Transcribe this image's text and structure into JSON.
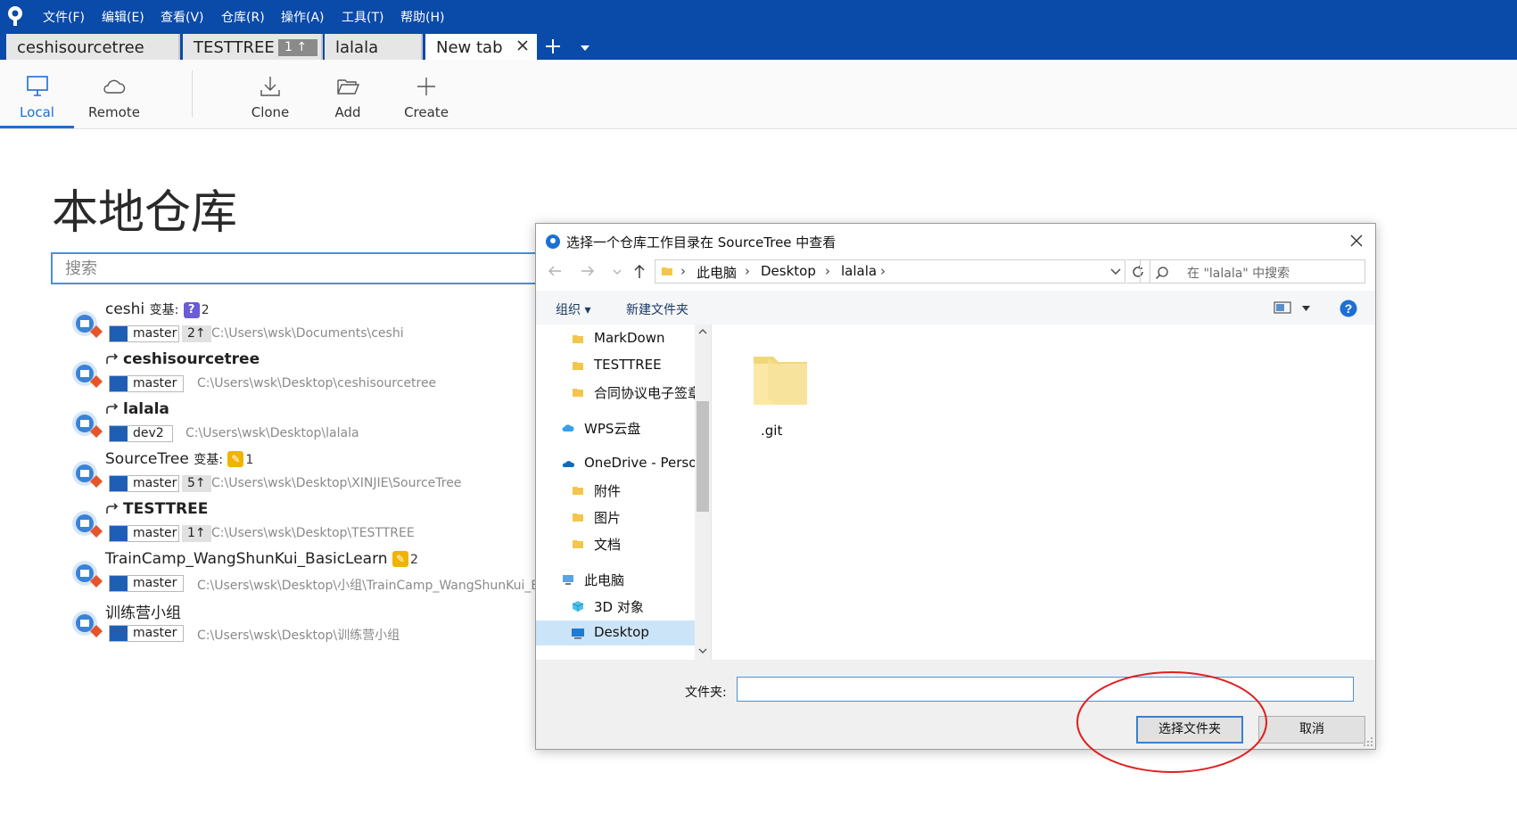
{
  "menu": [
    "文件(F)",
    "编辑(E)",
    "查看(V)",
    "仓库(R)",
    "操作(A)",
    "工具(T)",
    "帮助(H)"
  ],
  "tabs": [
    {
      "label": "ceshisourcetree"
    },
    {
      "label": "TESTTREE",
      "badge": "1 ↑"
    },
    {
      "label": "lalala"
    },
    {
      "label": "New tab"
    }
  ],
  "toolbar": {
    "local": "Local",
    "remote": "Remote",
    "clone": "Clone",
    "add": "Add",
    "create": "Create"
  },
  "page": {
    "title": "本地仓库",
    "search_placeholder": "搜索"
  },
  "repos": [
    {
      "name": "ceshi",
      "rebase": "变基:",
      "badge_type": "question",
      "badge_count": "2",
      "branch": "master",
      "ahead": "2↑",
      "path": "C:\\Users\\wsk\\Documents\\ceshi"
    },
    {
      "name": "ceshisourcetree",
      "fork": true,
      "branch": "master",
      "path": "C:\\Users\\wsk\\Desktop\\ceshisourcetree"
    },
    {
      "name": "lalala",
      "fork": true,
      "branch": "dev2",
      "path": "C:\\Users\\wsk\\Desktop\\lalala"
    },
    {
      "name": "SourceTree",
      "rebase": "变基:",
      "badge_type": "edit",
      "badge_count": "1",
      "branch": "master",
      "ahead": "5↑",
      "path": "C:\\Users\\wsk\\Desktop\\XINJIE\\SourceTree"
    },
    {
      "name": "TESTTREE",
      "fork": true,
      "branch": "master",
      "ahead": "1↑",
      "path": "C:\\Users\\wsk\\Desktop\\TESTTREE"
    },
    {
      "name": "TrainCamp_WangShunKui_BasicLearn",
      "badge_type": "edit",
      "badge_count": "2",
      "branch": "master",
      "path": "C:\\Users\\wsk\\Desktop\\小组\\TrainCamp_WangShunKui_Ba"
    },
    {
      "name": "训练营小组",
      "branch": "master",
      "path": "C:\\Users\\wsk\\Desktop\\训练营小组"
    }
  ],
  "dialog": {
    "title": "选择一个仓库工作目录在 SourceTree 中查看",
    "breadcrumb": [
      "此电脑",
      "Desktop",
      "lalala"
    ],
    "search_placeholder": "在 \"lalala\" 中搜索",
    "organize": "组织 ▾",
    "new_folder": "新建文件夹",
    "nav_items": [
      {
        "label": "MarkDown",
        "icon": "folder-icon"
      },
      {
        "label": "TESTTREE",
        "icon": "folder-icon"
      },
      {
        "label": "合同协议电子签章",
        "icon": "folder-icon"
      },
      {
        "label": "WPS云盘",
        "icon": "cloud-icon"
      },
      {
        "label": "OneDrive - Personal",
        "icon": "onedrive-icon"
      },
      {
        "label": "附件",
        "icon": "folder-icon"
      },
      {
        "label": "图片",
        "icon": "folder-icon"
      },
      {
        "label": "文档",
        "icon": "folder-icon"
      },
      {
        "label": "此电脑",
        "icon": "computer-icon"
      },
      {
        "label": "3D 对象",
        "icon": "cube-icon"
      },
      {
        "label": "Desktop",
        "icon": "desktop-icon"
      }
    ],
    "files": [
      {
        "name": ".git",
        "icon": "folder-icon"
      }
    ],
    "folder_label": "文件夹:",
    "folder_value": "",
    "select_button": "选择文件夹",
    "cancel_button": "取消"
  },
  "colors": {
    "titlebar": "#0a4aa8",
    "accent": "#1c6fd6",
    "annotation": "#e02020"
  }
}
